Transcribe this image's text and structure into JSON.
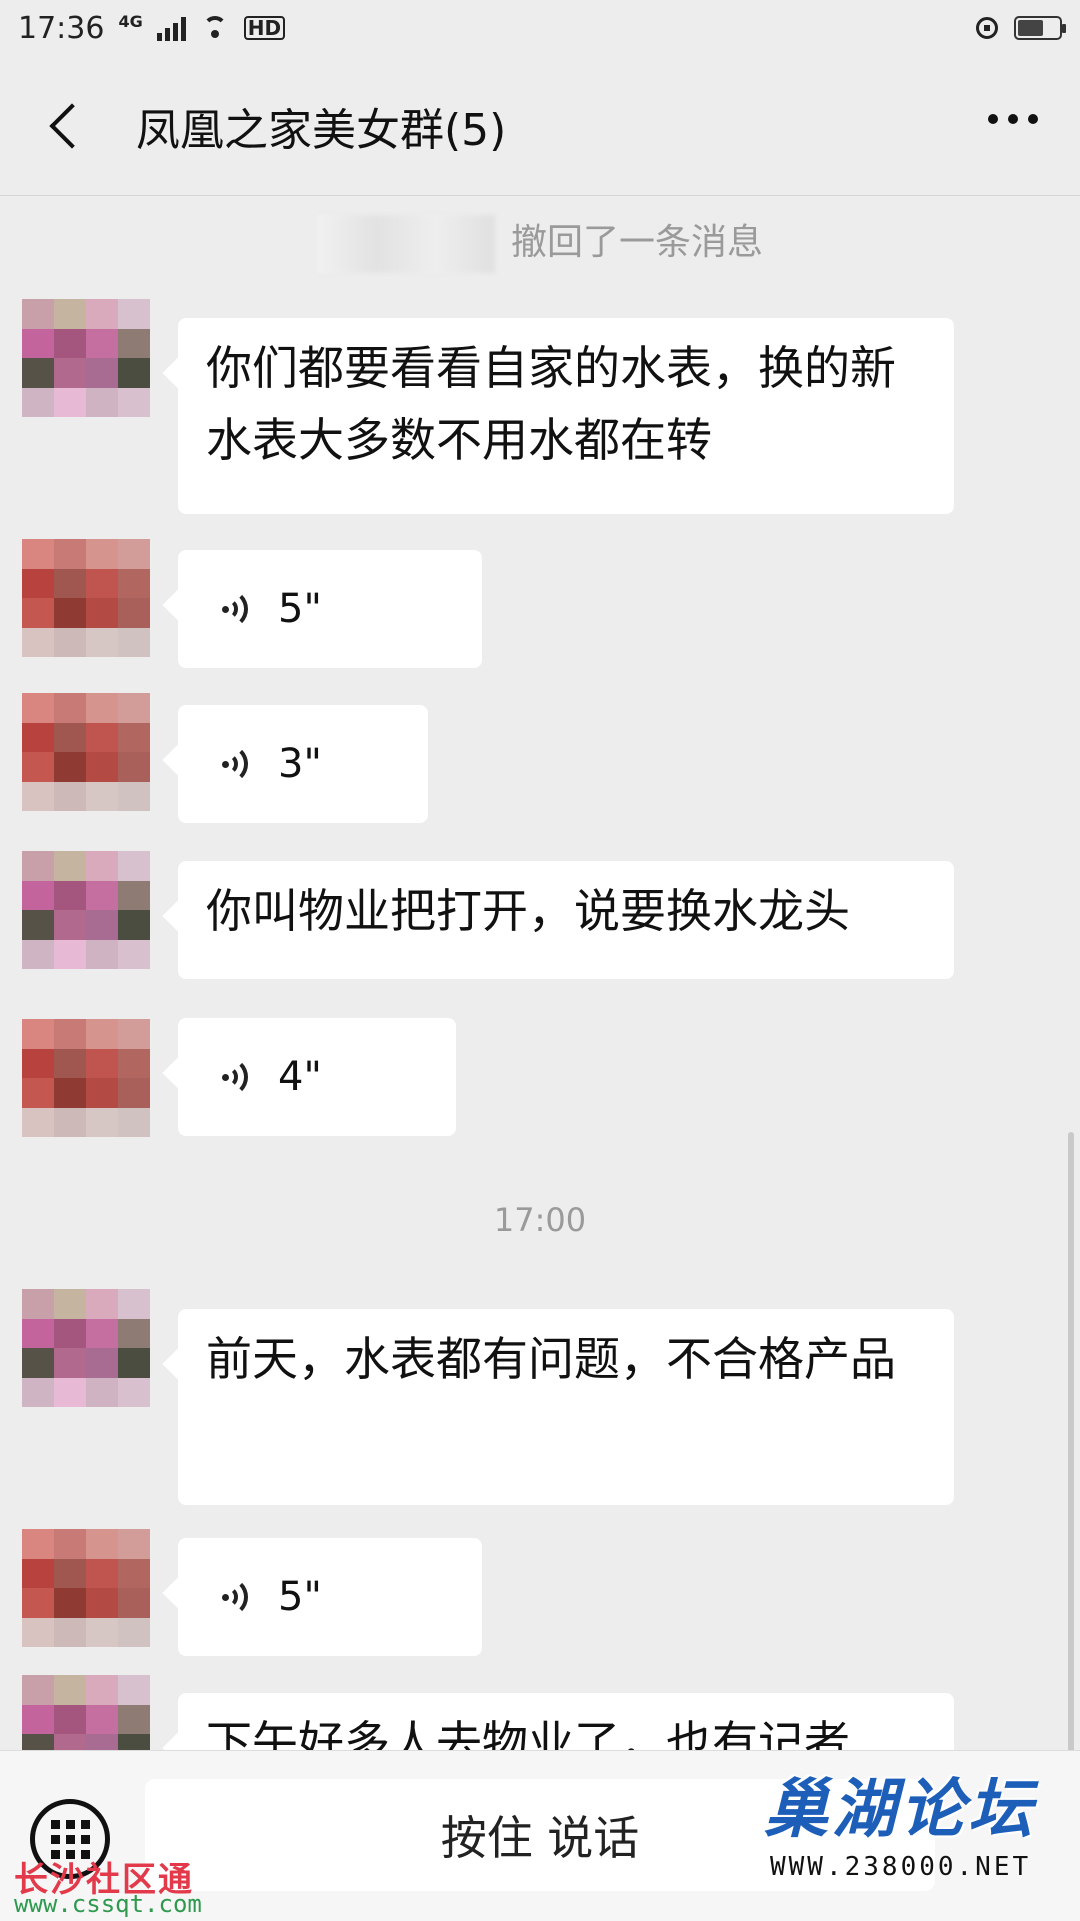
{
  "status_bar": {
    "time": "17:36",
    "network": "4G",
    "hd_label": "HD"
  },
  "header": {
    "title": "凤凰之家美女群(5)"
  },
  "chat": {
    "recall_notice": "撤回了一条消息",
    "timestamp": "17:00",
    "messages": [
      {
        "type": "text",
        "text": "你们都要看看自家的水表，换的新水表大多数不用水都在转"
      },
      {
        "type": "voice",
        "duration": "5\""
      },
      {
        "type": "voice",
        "duration": "3\""
      },
      {
        "type": "text",
        "text": "你叫物业把打开，说要换水龙头"
      },
      {
        "type": "voice",
        "duration": "4\""
      },
      {
        "type": "text",
        "text": "前天，水表都有问题，不合格产品"
      },
      {
        "type": "voice",
        "duration": "5\""
      },
      {
        "type": "text",
        "text": "下午好多人去物业了，也有记者"
      }
    ]
  },
  "bottom_bar": {
    "hold_to_talk": "按住 说话"
  },
  "watermarks": {
    "left_brand": "长沙社区通",
    "left_url": "www.cssqt.com",
    "right_brand": "巢湖论坛",
    "right_url": "WWW.238000.NET"
  },
  "avatar_colors": {
    "avatar_a": [
      "#c7a0a9",
      "#c5b5a0",
      "#d9aabc",
      "#d8c1ce",
      "#c3659c",
      "#a5567f",
      "#c46fa0",
      "#8d7b74",
      "#575248",
      "#b16a8e",
      "#a86b92",
      "#4b4d40",
      "#cfb4c4",
      "#e8b9d4",
      "#cfb3c2",
      "#d9c0cf"
    ],
    "avatar_b": [
      "#d98580",
      "#c77a76",
      "#d5948d",
      "#d29d99",
      "#b8433e",
      "#a05750",
      "#c0544f",
      "#b26660",
      "#c4574f",
      "#8f3b34",
      "#b34a44",
      "#a9605a",
      "#d8c3c1",
      "#cdbab8",
      "#d6c7c5",
      "#d0c2c0"
    ]
  }
}
